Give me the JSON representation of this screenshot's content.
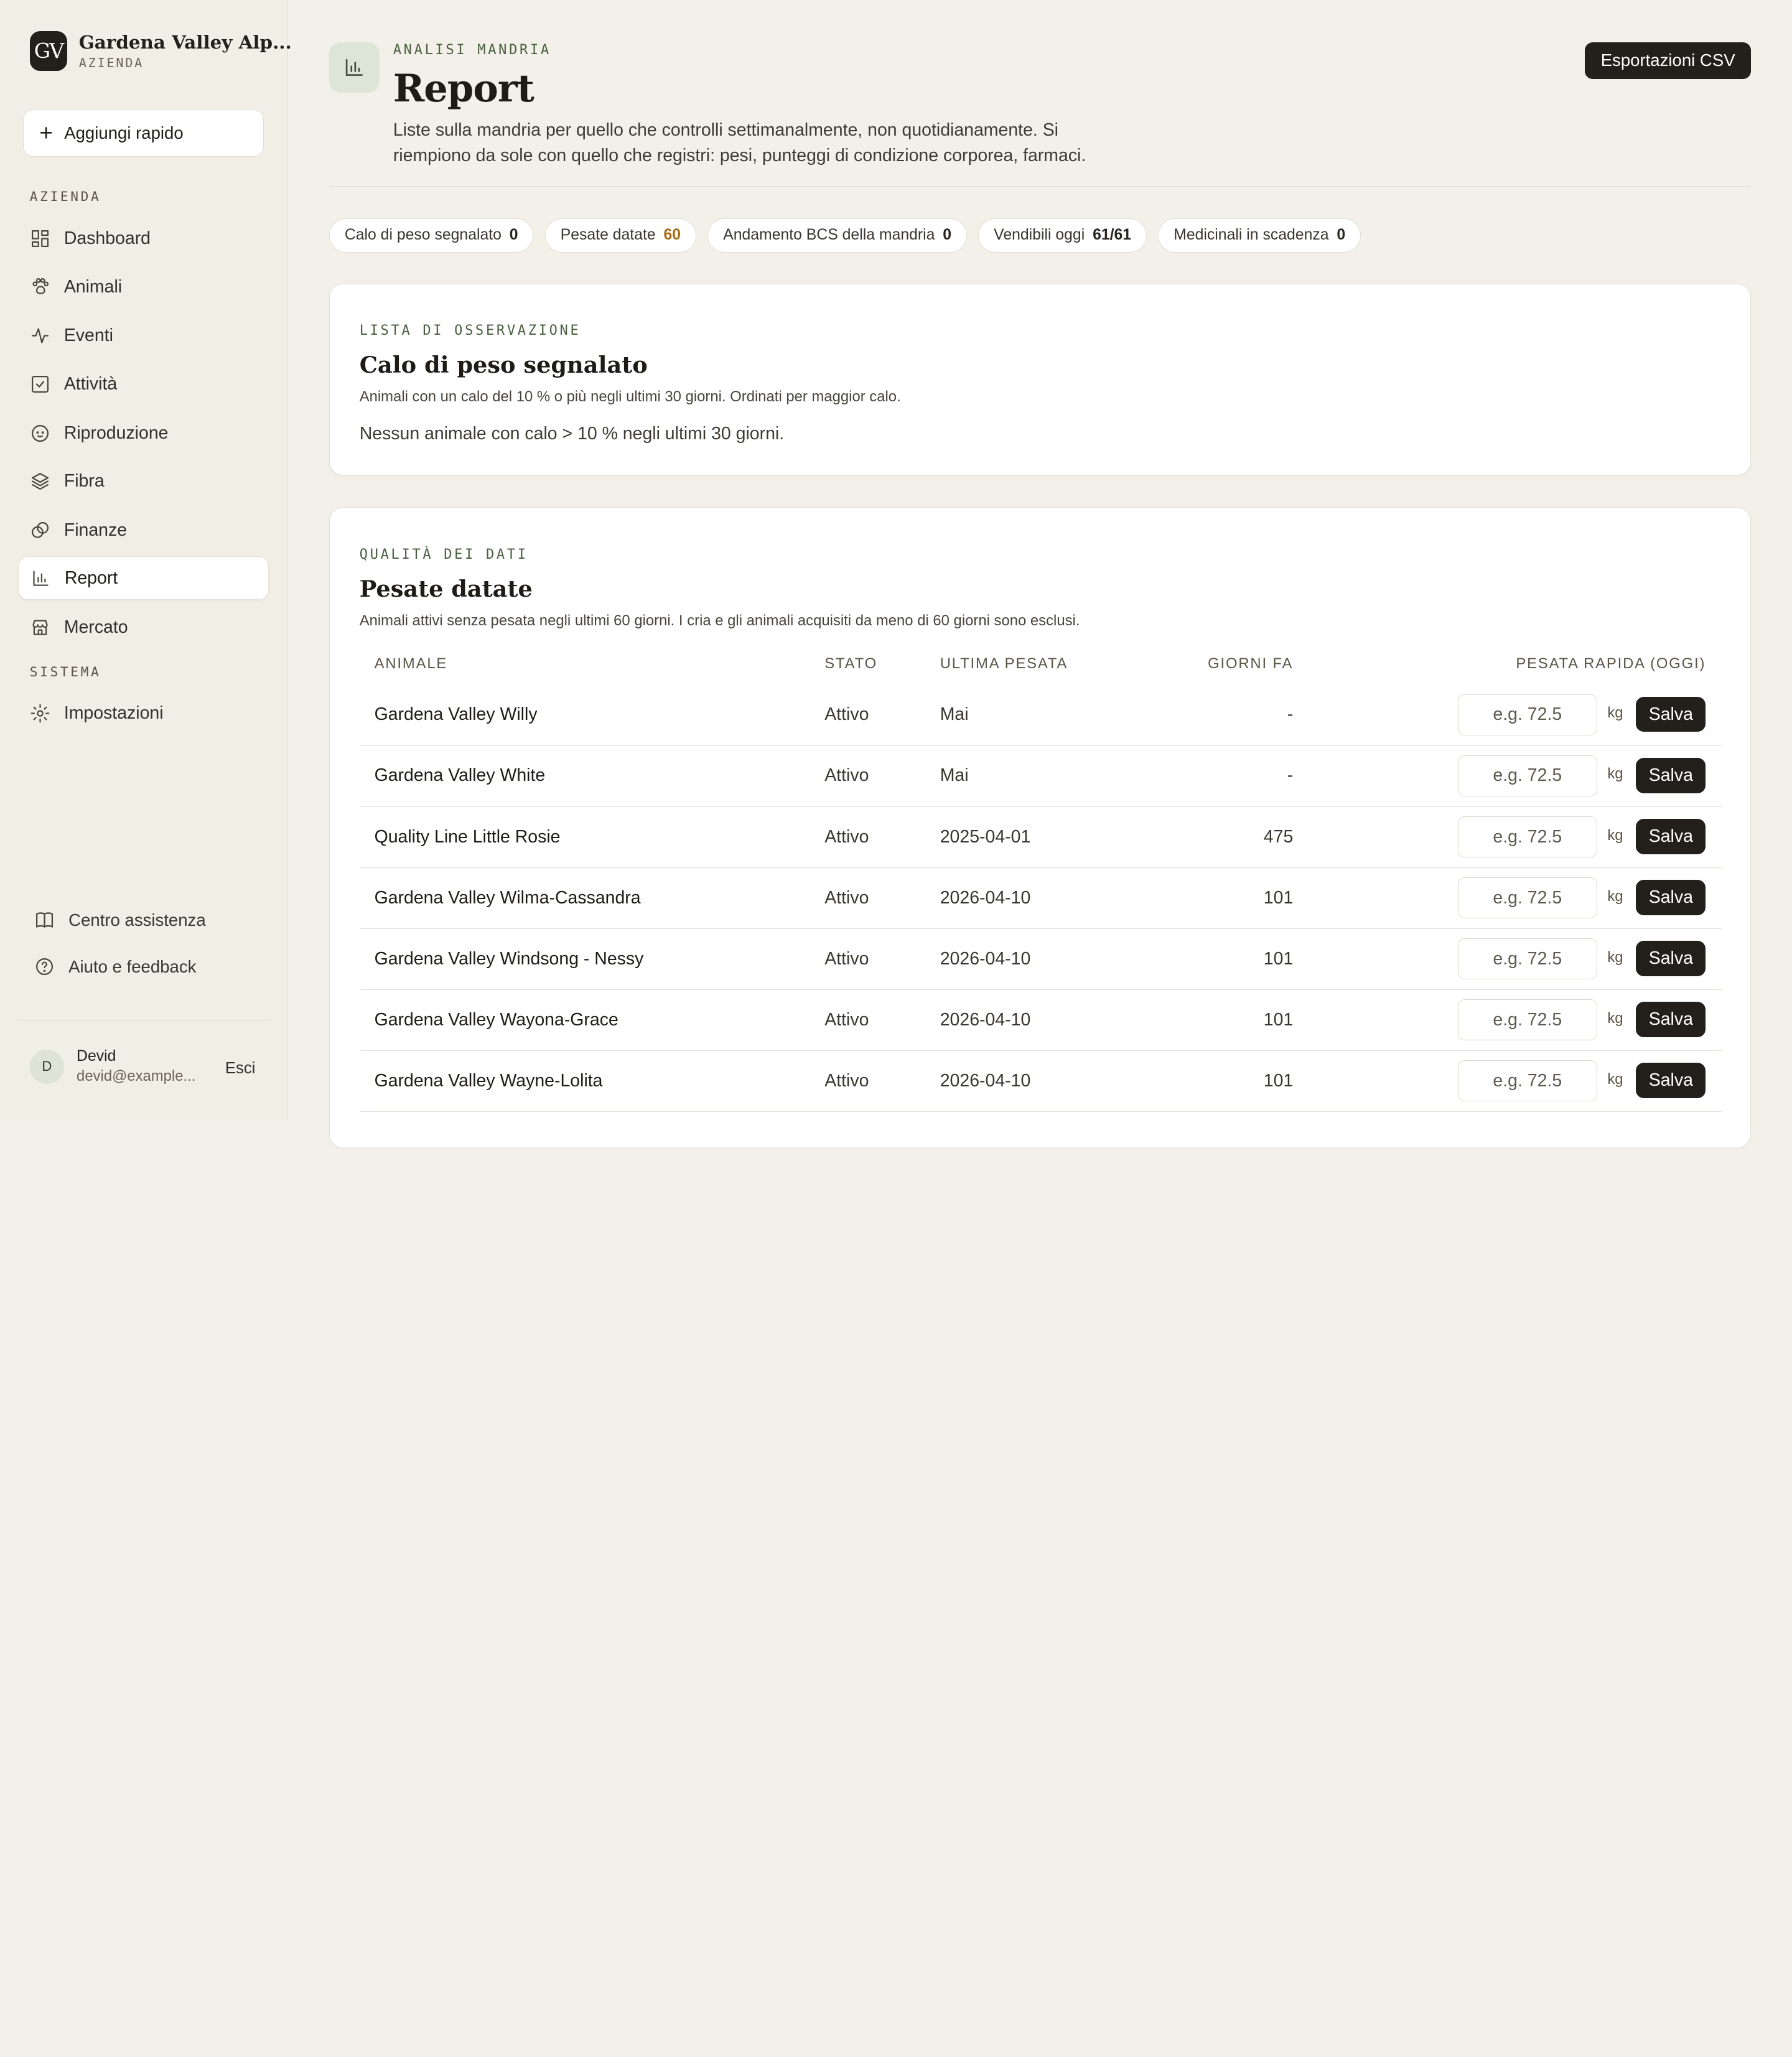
{
  "brand": {
    "logo": "GV",
    "name": "Gardena Valley Alp...",
    "sub": "AZIENDA"
  },
  "quick_add": {
    "label": "Aggiungi rapido",
    "icon": "plus-icon"
  },
  "sidebar": {
    "section_azienda": "AZIENDA",
    "section_sistema": "SISTEMA",
    "items": [
      {
        "label": "Dashboard",
        "icon": "dashboard-icon"
      },
      {
        "label": "Animali",
        "icon": "paw-icon"
      },
      {
        "label": "Eventi",
        "icon": "activity-icon"
      },
      {
        "label": "Attività",
        "icon": "checkbox-icon"
      },
      {
        "label": "Riproduzione",
        "icon": "baby-icon"
      },
      {
        "label": "Fibra",
        "icon": "layers-icon"
      },
      {
        "label": "Finanze",
        "icon": "coins-icon"
      },
      {
        "label": "Report",
        "icon": "bar-chart-icon",
        "active": true
      },
      {
        "label": "Mercato",
        "icon": "store-icon"
      }
    ],
    "system_items": [
      {
        "label": "Impostazioni",
        "icon": "gear-icon"
      }
    ],
    "footer_links": [
      {
        "label": "Centro assistenza",
        "icon": "book-icon"
      },
      {
        "label": "Aiuto e feedback",
        "icon": "help-circle-icon"
      }
    ],
    "user": {
      "initial": "D",
      "name": "Devid",
      "email": "devid@example...",
      "logout": "Esci"
    }
  },
  "header": {
    "eyebrow": "ANALISI MANDRIA",
    "title": "Report",
    "description": "Liste sulla mandria per quello che controlli settimanalmente, non quotidianamente. Si riempiono da sole con quello che registri: pesi, punteggi di condizione corporea, farmaci.",
    "export_label": "Esportazioni CSV",
    "icon": "bar-chart-icon"
  },
  "chips": [
    {
      "label": "Calo di peso segnalato",
      "count": "0"
    },
    {
      "label": "Pesate datate",
      "count": "60",
      "highlight": true
    },
    {
      "label": "Andamento BCS della mandria",
      "count": "0"
    },
    {
      "label": "Vendibili oggi",
      "count": "61/61"
    },
    {
      "label": "Medicinali in scadenza",
      "count": "0"
    }
  ],
  "watchlist": {
    "eyebrow": "LISTA DI OSSERVAZIONE",
    "title": "Calo di peso segnalato",
    "description": "Animali con un calo del 10 % o più negli ultimi 30 giorni. Ordinati per maggior calo.",
    "empty": "Nessun animale con calo > 10 % negli ultimi 30 giorni."
  },
  "data_quality": {
    "eyebrow": "QUALITÀ DEI DATI",
    "title": "Pesate datate",
    "description": "Animali attivi senza pesata negli ultimi 60 giorni. I cria e gli animali acquisiti da meno di 60 giorni sono esclusi.",
    "columns": {
      "animal": "ANIMALE",
      "status": "STATO",
      "last": "ULTIMA PESATA",
      "days": "GIORNI FA",
      "quick": "PESATA RAPIDA (OGGI)"
    },
    "input_placeholder": "e.g. 72.5",
    "unit": "kg",
    "save_label": "Salva",
    "rows": [
      {
        "name": "Gardena Valley Willy",
        "status": "Attivo",
        "last": "Mai",
        "days": "-"
      },
      {
        "name": "Gardena Valley White",
        "status": "Attivo",
        "last": "Mai",
        "days": "-"
      },
      {
        "name": "Quality Line Little Rosie",
        "status": "Attivo",
        "last": "2025-04-01",
        "days": "475"
      },
      {
        "name": "Gardena Valley Wilma-Cassandra",
        "status": "Attivo",
        "last": "2026-04-10",
        "days": "101"
      },
      {
        "name": "Gardena Valley Windsong - Nessy",
        "status": "Attivo",
        "last": "2026-04-10",
        "days": "101"
      },
      {
        "name": "Gardena Valley Wayona-Grace",
        "status": "Attivo",
        "last": "2026-04-10",
        "days": "101"
      },
      {
        "name": "Gardena Valley Wayne-Lolita",
        "status": "Attivo",
        "last": "2026-04-10",
        "days": "101"
      }
    ]
  }
}
